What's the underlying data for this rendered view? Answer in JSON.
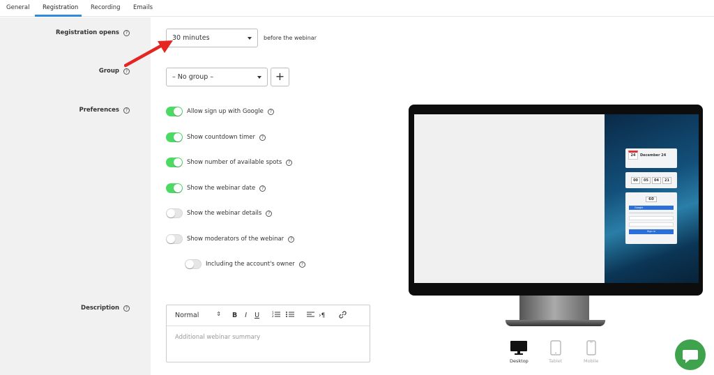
{
  "tabs": [
    "General",
    "Registration",
    "Recording",
    "Emails"
  ],
  "registration_opens": {
    "label": "Registration opens",
    "value": "30 minutes",
    "suffix": "before the webinar"
  },
  "group": {
    "label": "Group",
    "value": "– No group –",
    "add_label": "+"
  },
  "preferences": {
    "label": "Preferences",
    "items": [
      {
        "label": "Allow sign up with Google",
        "on": true
      },
      {
        "label": "Show countdown timer",
        "on": true
      },
      {
        "label": "Show number of available spots",
        "on": true
      },
      {
        "label": "Show the webinar date",
        "on": true
      },
      {
        "label": "Show the webinar details",
        "on": false
      },
      {
        "label": "Show moderators of the webinar",
        "on": false
      },
      {
        "label": "Including the account's owner",
        "on": false
      }
    ]
  },
  "description": {
    "label": "Description",
    "placeholder": "Additional webinar summary",
    "format": "Normal",
    "bold": "B",
    "italic": "I",
    "underline": "U"
  },
  "help_glyph": "?",
  "preview": {
    "date_day": "24",
    "date_month": "December",
    "date_text": "December 24",
    "countdown": [
      "00",
      "05",
      "04",
      "21"
    ],
    "spots": "60",
    "google_btn": "Google",
    "signin_btn": "Sign in"
  },
  "devices": [
    "Desktop",
    "Tablet",
    "Mobile"
  ],
  "colors": {
    "accent": "#2e8bdb",
    "toggle_on": "#4cd964",
    "arrow": "#e52521",
    "chat": "#3fa34d"
  }
}
